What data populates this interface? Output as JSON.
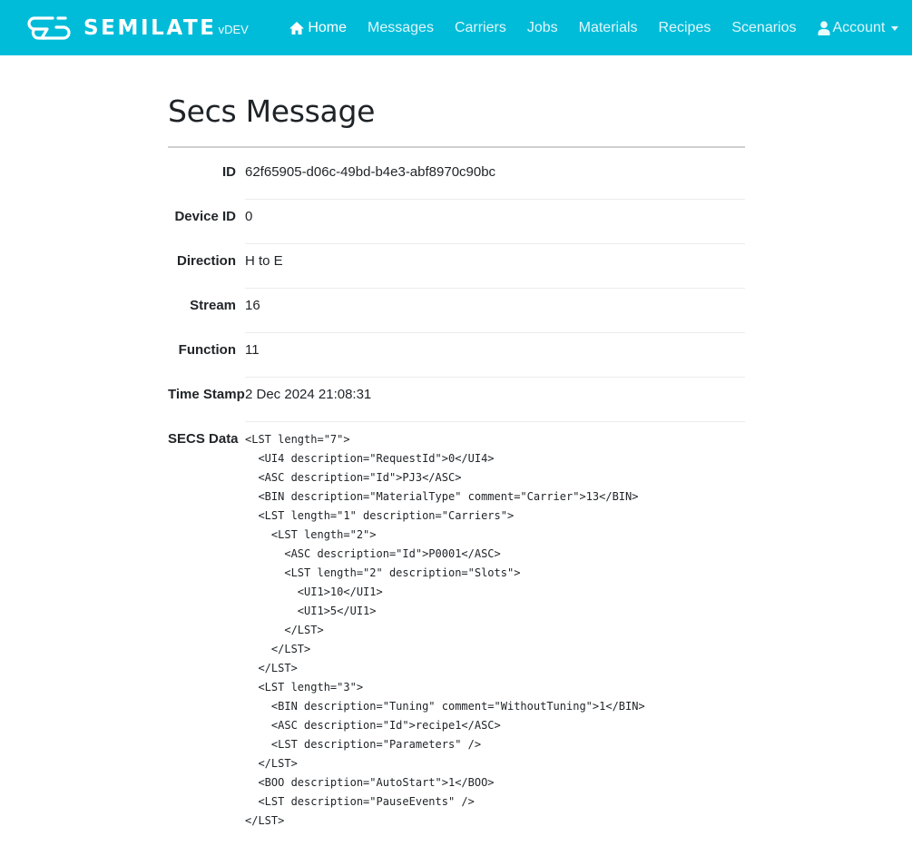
{
  "brand": {
    "name": "SEMILATE",
    "version": "vDEV",
    "logo_icon": "semilate-logo-icon"
  },
  "nav": {
    "items": [
      {
        "label": "Home",
        "icon": "home-icon"
      },
      {
        "label": "Messages"
      },
      {
        "label": "Carriers"
      },
      {
        "label": "Jobs"
      },
      {
        "label": "Materials"
      },
      {
        "label": "Recipes"
      },
      {
        "label": "Scenarios"
      },
      {
        "label": "Account",
        "icon": "user-icon",
        "dropdown": true
      }
    ]
  },
  "page": {
    "title": "Secs Message"
  },
  "fields": {
    "id": {
      "label": "ID",
      "value": "62f65905-d06c-49bd-b4e3-abf8970c90bc"
    },
    "device_id": {
      "label": "Device ID",
      "value": "0"
    },
    "direction": {
      "label": "Direction",
      "value": "H to E"
    },
    "stream": {
      "label": "Stream",
      "value": "16"
    },
    "function": {
      "label": "Function",
      "value": "11"
    },
    "timestamp": {
      "label": "Time Stamp",
      "value": "2 Dec 2024 21:08:31"
    },
    "secs_data": {
      "label": "SECS Data",
      "value": "<LST length=\"7\">\n  <UI4 description=\"RequestId\">0</UI4>\n  <ASC description=\"Id\">PJ3</ASC>\n  <BIN description=\"MaterialType\" comment=\"Carrier\">13</BIN>\n  <LST length=\"1\" description=\"Carriers\">\n    <LST length=\"2\">\n      <ASC description=\"Id\">P0001</ASC>\n      <LST length=\"2\" description=\"Slots\">\n        <UI1>10</UI1>\n        <UI1>5</UI1>\n      </LST>\n    </LST>\n  </LST>\n  <LST length=\"3\">\n    <BIN description=\"Tuning\" comment=\"WithoutTuning\">1</BIN>\n    <ASC description=\"Id\">recipe1</ASC>\n    <LST description=\"Parameters\" />\n  </LST>\n  <BOO description=\"AutoStart\">1</BOO>\n  <LST description=\"PauseEvents\" />\n</LST>"
    }
  }
}
